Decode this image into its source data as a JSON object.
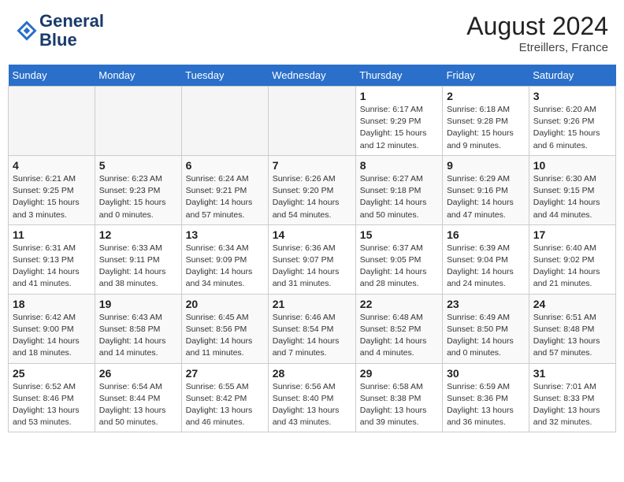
{
  "header": {
    "logo_line1": "General",
    "logo_line2": "Blue",
    "month_year": "August 2024",
    "location": "Etreillers, France"
  },
  "weekdays": [
    "Sunday",
    "Monday",
    "Tuesday",
    "Wednesday",
    "Thursday",
    "Friday",
    "Saturday"
  ],
  "weeks": [
    [
      {
        "day": "",
        "info": ""
      },
      {
        "day": "",
        "info": ""
      },
      {
        "day": "",
        "info": ""
      },
      {
        "day": "",
        "info": ""
      },
      {
        "day": "1",
        "info": "Sunrise: 6:17 AM\nSunset: 9:29 PM\nDaylight: 15 hours and 12 minutes."
      },
      {
        "day": "2",
        "info": "Sunrise: 6:18 AM\nSunset: 9:28 PM\nDaylight: 15 hours and 9 minutes."
      },
      {
        "day": "3",
        "info": "Sunrise: 6:20 AM\nSunset: 9:26 PM\nDaylight: 15 hours and 6 minutes."
      }
    ],
    [
      {
        "day": "4",
        "info": "Sunrise: 6:21 AM\nSunset: 9:25 PM\nDaylight: 15 hours and 3 minutes."
      },
      {
        "day": "5",
        "info": "Sunrise: 6:23 AM\nSunset: 9:23 PM\nDaylight: 15 hours and 0 minutes."
      },
      {
        "day": "6",
        "info": "Sunrise: 6:24 AM\nSunset: 9:21 PM\nDaylight: 14 hours and 57 minutes."
      },
      {
        "day": "7",
        "info": "Sunrise: 6:26 AM\nSunset: 9:20 PM\nDaylight: 14 hours and 54 minutes."
      },
      {
        "day": "8",
        "info": "Sunrise: 6:27 AM\nSunset: 9:18 PM\nDaylight: 14 hours and 50 minutes."
      },
      {
        "day": "9",
        "info": "Sunrise: 6:29 AM\nSunset: 9:16 PM\nDaylight: 14 hours and 47 minutes."
      },
      {
        "day": "10",
        "info": "Sunrise: 6:30 AM\nSunset: 9:15 PM\nDaylight: 14 hours and 44 minutes."
      }
    ],
    [
      {
        "day": "11",
        "info": "Sunrise: 6:31 AM\nSunset: 9:13 PM\nDaylight: 14 hours and 41 minutes."
      },
      {
        "day": "12",
        "info": "Sunrise: 6:33 AM\nSunset: 9:11 PM\nDaylight: 14 hours and 38 minutes."
      },
      {
        "day": "13",
        "info": "Sunrise: 6:34 AM\nSunset: 9:09 PM\nDaylight: 14 hours and 34 minutes."
      },
      {
        "day": "14",
        "info": "Sunrise: 6:36 AM\nSunset: 9:07 PM\nDaylight: 14 hours and 31 minutes."
      },
      {
        "day": "15",
        "info": "Sunrise: 6:37 AM\nSunset: 9:05 PM\nDaylight: 14 hours and 28 minutes."
      },
      {
        "day": "16",
        "info": "Sunrise: 6:39 AM\nSunset: 9:04 PM\nDaylight: 14 hours and 24 minutes."
      },
      {
        "day": "17",
        "info": "Sunrise: 6:40 AM\nSunset: 9:02 PM\nDaylight: 14 hours and 21 minutes."
      }
    ],
    [
      {
        "day": "18",
        "info": "Sunrise: 6:42 AM\nSunset: 9:00 PM\nDaylight: 14 hours and 18 minutes."
      },
      {
        "day": "19",
        "info": "Sunrise: 6:43 AM\nSunset: 8:58 PM\nDaylight: 14 hours and 14 minutes."
      },
      {
        "day": "20",
        "info": "Sunrise: 6:45 AM\nSunset: 8:56 PM\nDaylight: 14 hours and 11 minutes."
      },
      {
        "day": "21",
        "info": "Sunrise: 6:46 AM\nSunset: 8:54 PM\nDaylight: 14 hours and 7 minutes."
      },
      {
        "day": "22",
        "info": "Sunrise: 6:48 AM\nSunset: 8:52 PM\nDaylight: 14 hours and 4 minutes."
      },
      {
        "day": "23",
        "info": "Sunrise: 6:49 AM\nSunset: 8:50 PM\nDaylight: 14 hours and 0 minutes."
      },
      {
        "day": "24",
        "info": "Sunrise: 6:51 AM\nSunset: 8:48 PM\nDaylight: 13 hours and 57 minutes."
      }
    ],
    [
      {
        "day": "25",
        "info": "Sunrise: 6:52 AM\nSunset: 8:46 PM\nDaylight: 13 hours and 53 minutes."
      },
      {
        "day": "26",
        "info": "Sunrise: 6:54 AM\nSunset: 8:44 PM\nDaylight: 13 hours and 50 minutes."
      },
      {
        "day": "27",
        "info": "Sunrise: 6:55 AM\nSunset: 8:42 PM\nDaylight: 13 hours and 46 minutes."
      },
      {
        "day": "28",
        "info": "Sunrise: 6:56 AM\nSunset: 8:40 PM\nDaylight: 13 hours and 43 minutes."
      },
      {
        "day": "29",
        "info": "Sunrise: 6:58 AM\nSunset: 8:38 PM\nDaylight: 13 hours and 39 minutes."
      },
      {
        "day": "30",
        "info": "Sunrise: 6:59 AM\nSunset: 8:36 PM\nDaylight: 13 hours and 36 minutes."
      },
      {
        "day": "31",
        "info": "Sunrise: 7:01 AM\nSunset: 8:33 PM\nDaylight: 13 hours and 32 minutes."
      }
    ]
  ]
}
